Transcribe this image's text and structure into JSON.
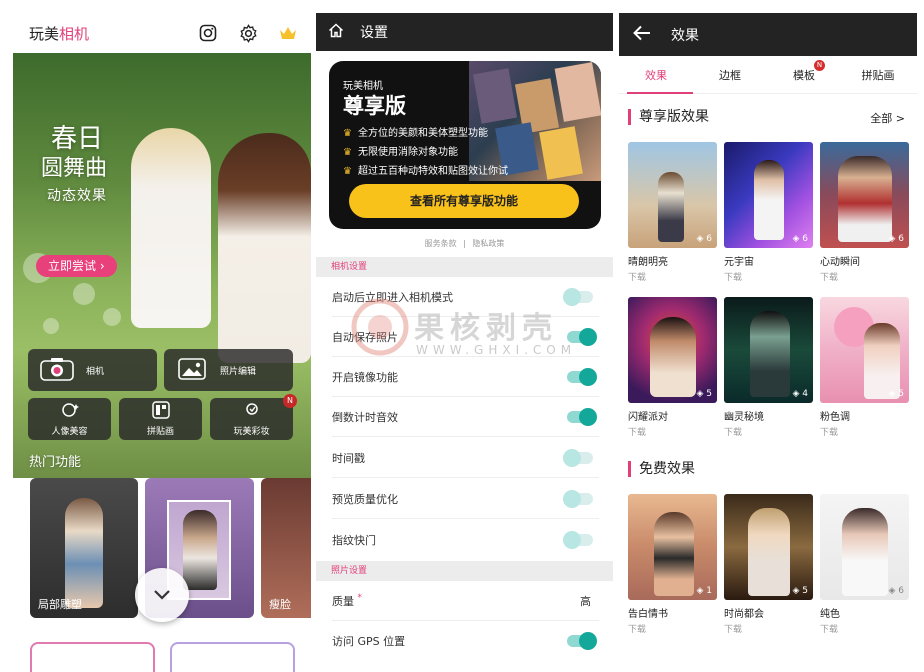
{
  "home": {
    "brand_prefix": "玩美",
    "brand_accent": "相机",
    "hero": {
      "title_line1": "春日",
      "title_line2": "圆舞曲",
      "title_line3": "动态效果",
      "try_label": "立即尝试"
    },
    "tiles": {
      "camera": "相机",
      "photo_edit": "照片编辑",
      "portrait": "人像美容",
      "collage": "拼贴画",
      "makeup": "玩美彩妆",
      "makeup_badge": "N"
    },
    "hot_title": "热门功能",
    "hot_items": [
      "局部雕塑",
      "",
      "瘦脸"
    ]
  },
  "settings": {
    "title": "设置",
    "premium": {
      "subtitle": "玩美相机",
      "title": "尊享版",
      "features": [
        "全方位的美颜和美体塑型功能",
        "无限使用消除对象功能",
        "超过五百种动特效和贴图效让你试"
      ],
      "cta": "查看所有尊享版功能"
    },
    "links": [
      "服务条款",
      "|",
      "隐私政策"
    ],
    "section_camera": "相机设置",
    "rows_camera": [
      {
        "label": "启动后立即进入相机模式",
        "on": false
      },
      {
        "label": "自动保存照片",
        "on": true
      },
      {
        "label": "开启镜像功能",
        "on": true
      },
      {
        "label": "倒数计时音效",
        "on": true
      },
      {
        "label": "时间戳",
        "on": false
      },
      {
        "label": "预览质量优化",
        "on": false
      },
      {
        "label": "指纹快门",
        "on": false
      }
    ],
    "section_photo": "照片设置",
    "quality_label": "质量",
    "quality_required": "*",
    "quality_value": "高",
    "gps_label": "访问 GPS 位置",
    "gps_on": true,
    "watermark_cn": "果核剥壳",
    "watermark_url": "WWW.GHXI.COM"
  },
  "effects": {
    "title": "效果",
    "tabs": [
      "效果",
      "边框",
      "模板",
      "拼贴画"
    ],
    "tab_badge": "N",
    "premium_title": "尊享版效果",
    "all_label": "全部 >",
    "premium_items": [
      {
        "name": "晴朗明亮",
        "dl": "下载",
        "cnt": "6"
      },
      {
        "name": "元宇宙",
        "dl": "下载",
        "cnt": "6"
      },
      {
        "name": "心动瞬间",
        "dl": "下载",
        "cnt": "6"
      },
      {
        "name": "闪耀派对",
        "dl": "下载",
        "cnt": "5"
      },
      {
        "name": "幽灵秘境",
        "dl": "下载",
        "cnt": "4"
      },
      {
        "name": "粉色调",
        "dl": "下载",
        "cnt": "5"
      }
    ],
    "free_title": "免费效果",
    "free_items": [
      {
        "name": "告白情书",
        "dl": "下载",
        "cnt": "1"
      },
      {
        "name": "时尚都会",
        "dl": "下载",
        "cnt": "5"
      },
      {
        "name": "纯色",
        "dl": "下载",
        "cnt": "6"
      }
    ]
  },
  "colors": {
    "accent": "#e0407a",
    "toggle_on": "#14a89a",
    "gold": "#f9c21a"
  }
}
